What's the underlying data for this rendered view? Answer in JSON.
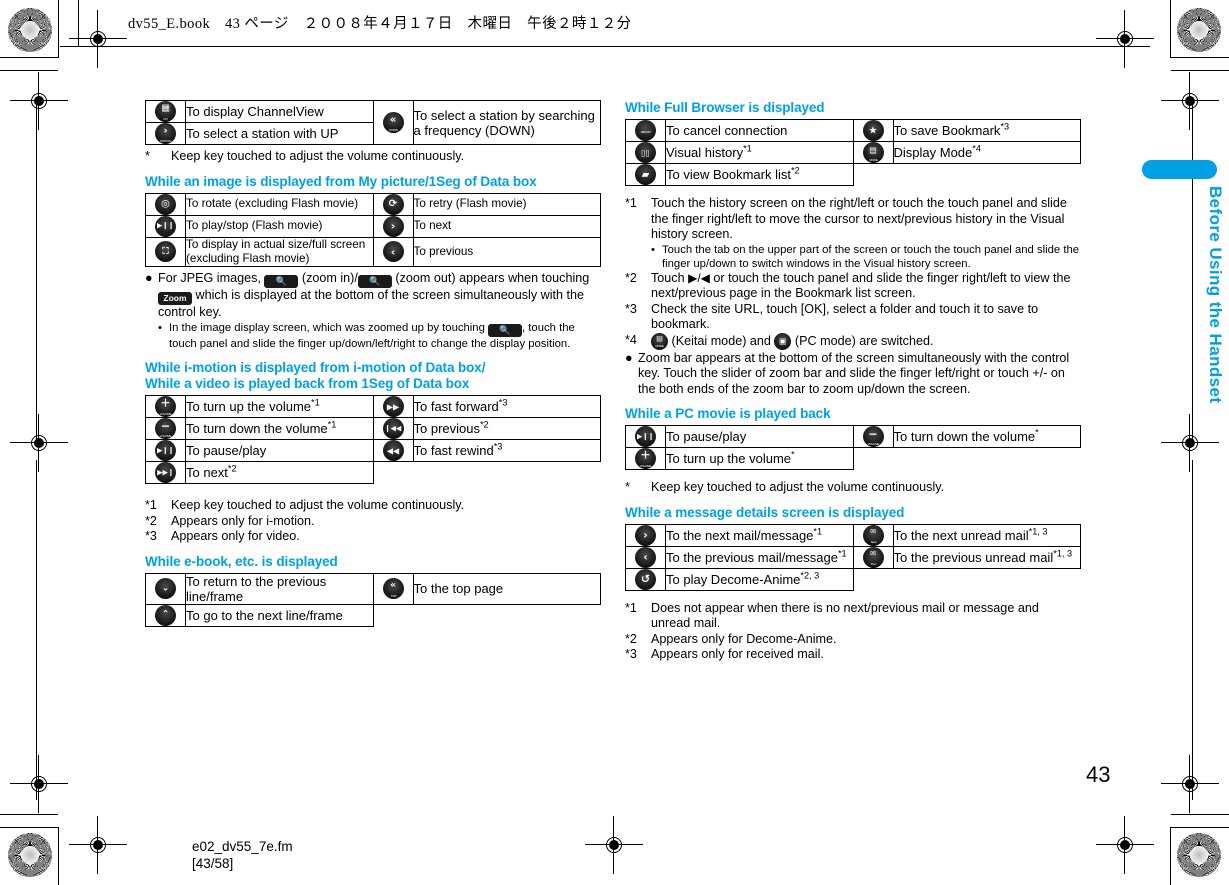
{
  "header": {
    "text": "dv55_E.book　43 ページ　２００８年４月１７日　木曜日　午後２時１２分"
  },
  "side_tab": {
    "label": "Before Using the Handset"
  },
  "footer": {
    "page_number": "43",
    "file_name": "e02_dv55_7e.fm",
    "file_range": "[43/58]"
  },
  "colors": {
    "accent": "#00a0e3",
    "text": "#000000",
    "icon": "#000000"
  },
  "left_column": {
    "table_channelview": {
      "rows": [
        {
          "icon": "channelview-key-icon",
          "glyph": "▦",
          "sub": "CH",
          "text": "To display ChannelView",
          "icon2": "search-down-key-icon",
          "glyph2": "«",
          "sub2": "DOWN",
          "text2": "To select a station by searching a frequency (DOWN)",
          "rowspan2": 2
        },
        {
          "icon": "station-up-key-icon",
          "glyph": "›",
          "sub": "STATION",
          "text": "To select a station with UP"
        }
      ]
    },
    "note_star": {
      "mark": "*",
      "text": "Keep key touched to adjust the volume continuously."
    },
    "section_image": {
      "title": "While an image is displayed from My picture/1Seg of Data box",
      "rows": [
        {
          "icon": "rotate-key-icon",
          "glyph": "◎",
          "sub": "ROTATE",
          "text": "To rotate (excluding Flash movie)",
          "icon2": "retry-key-icon",
          "glyph2": "⟳",
          "sub2": "RETRY",
          "text2": "To retry (Flash movie)"
        },
        {
          "icon": "play-stop-key-icon",
          "glyph": "▶❙❙",
          "sub": "",
          "text": "To play/stop (Flash movie)",
          "icon2": "next-key-icon",
          "glyph2": "›",
          "sub2": "",
          "text2": "To next"
        },
        {
          "icon": "actual-size-key-icon",
          "glyph": "⛶",
          "sub": "SIZE",
          "text": "To display in actual size/full screen (excluding Flash movie)",
          "icon2": "previous-key-icon",
          "glyph2": "‹",
          "sub2": "",
          "text2": "To previous"
        }
      ]
    },
    "jpeg_bullet": {
      "part1": "For JPEG images,",
      "zoom_in_label": "zoom-in-button",
      "part2": "(zoom in)/",
      "zoom_out_label": "zoom-out-button",
      "part3": "(zoom out) appears when touching",
      "zoom_pill": "Zoom",
      "part4": "which is displayed at the bottom of the screen simultaneously with the control key."
    },
    "jpeg_subbullet": {
      "part1": "In the image display screen, which was zoomed up by touching",
      "part2": ", touch the touch panel and slide the finger up/down/left/right to change the display position."
    },
    "section_imotion": {
      "title_line1": "While i-motion is displayed from i-motion of Data box/",
      "title_line2": "While a video is played back from 1Seg of Data box",
      "rows": [
        {
          "icon": "volume-up-key-icon",
          "glyph": "＋",
          "sub": "VOLUME",
          "text": "To turn up the volume",
          "sup": "*1",
          "icon2": "fast-forward-key-icon",
          "glyph2": "▶▶",
          "sub2": "",
          "text2": "To fast forward",
          "sup2": "*3"
        },
        {
          "icon": "volume-down-key-icon",
          "glyph": "−",
          "sub": "VOLUME",
          "text": "To turn down the volume",
          "sup": "*1",
          "icon2": "previous-track-key-icon",
          "glyph2": "❙◀◀",
          "sub2": "",
          "text2": "To previous",
          "sup2": "*2"
        },
        {
          "icon": "pause-play-key-icon",
          "glyph": "▶❙❙",
          "sub": "",
          "text": "To pause/play",
          "sup": "",
          "icon2": "fast-rewind-key-icon",
          "glyph2": "◀◀",
          "sub2": "",
          "text2": "To fast rewind",
          "sup2": "*3"
        },
        {
          "icon": "next-track-key-icon",
          "glyph": "▶▶❙",
          "sub": "",
          "text": "To next",
          "sup": "*2"
        }
      ]
    },
    "footnotes_imotion": [
      {
        "mark": "*1",
        "text": "Keep key touched to adjust the volume continuously."
      },
      {
        "mark": "*2",
        "text": "Appears only for i-motion."
      },
      {
        "mark": "*3",
        "text": "Appears only for video."
      }
    ],
    "section_ebook": {
      "title": "While e-book, etc. is displayed",
      "rows": [
        {
          "icon": "previous-line-key-icon",
          "glyph": "⌄",
          "sub": "",
          "text": "To return to the previous line/frame",
          "icon2": "top-page-key-icon",
          "glyph2": "«",
          "sub2": "TOP",
          "text2": "To the top page"
        },
        {
          "icon": "next-line-key-icon",
          "glyph": "⌃",
          "sub": "",
          "text": "To go to the next line/frame"
        }
      ]
    }
  },
  "right_column": {
    "section_fullbrowser": {
      "title": "While Full Browser is displayed",
      "rows": [
        {
          "icon": "cancel-connection-key-icon",
          "glyph": "",
          "sub": "cancel",
          "text": "To cancel connection",
          "sup": "",
          "icon2": "save-bookmark-key-icon",
          "glyph2": "★",
          "sub2": "",
          "text2": "To save Bookmark",
          "sup2": "*3"
        },
        {
          "icon": "visual-history-key-icon",
          "glyph": "▯▯",
          "sub": "",
          "text": "Visual history",
          "sup": "*1",
          "icon2": "display-mode-key-icon",
          "glyph2": "▤",
          "sub2": "MODE",
          "text2": "Display Mode",
          "sup2": "*4"
        },
        {
          "icon": "bookmark-list-key-icon",
          "glyph": "▰",
          "sub": "",
          "text": "To view Bookmark list",
          "sup": "*2"
        }
      ]
    },
    "footnotes_browser": [
      {
        "mark": "*1",
        "text": "Touch the history screen on the right/left or touch the touch panel and slide the finger right/left to move the cursor to next/previous history in the Visual history screen."
      },
      {
        "mark": "*2",
        "prefix": "Touch ",
        "glyph": "▶/◀",
        "text": " or touch the touch panel and slide the finger right/left to view the next/previous page in the Bookmark list screen."
      },
      {
        "mark": "*3",
        "text": "Check the site URL, touch [OK], select a folder and touch it to save to bookmark."
      },
      {
        "mark": "*4",
        "text_before": "(Keitai mode) and",
        "text_after": "(PC mode) are switched."
      }
    ],
    "subbullet_browser": "Touch the tab on the upper part of the screen or touch the touch panel and slide the finger up/down to switch windows in the Visual history screen.",
    "bullet_zoombar": "Zoom bar appears at the bottom of the screen simultaneously with the control key. Touch the slider of zoom bar and slide the finger left/right or touch +/- on the both ends of the zoom bar to zoom up/down the screen.",
    "section_pcmovie": {
      "title": "While a PC movie is played back",
      "rows": [
        {
          "icon": "pause-play-key-icon",
          "glyph": "▶❙❙",
          "sub": "",
          "text": "To pause/play",
          "sup": "",
          "icon2": "volume-down-key-icon",
          "glyph2": "−",
          "sub2": "VOLUME",
          "text2": "To turn down the volume",
          "sup2": "*"
        },
        {
          "icon": "volume-up-key-icon",
          "glyph": "＋",
          "sub": "VOLUME",
          "text": "To turn up the volume",
          "sup": "*"
        }
      ],
      "note": {
        "mark": "*",
        "text": "Keep key touched to adjust the volume continuously."
      }
    },
    "section_message": {
      "title": "While a message details screen is displayed",
      "rows": [
        {
          "icon": "next-mail-key-icon",
          "glyph": "›",
          "sub": "",
          "text": "To the next mail/message",
          "sup": "*1",
          "icon2": "next-unread-mail-key-icon",
          "glyph2": "✉",
          "sub2": "Next",
          "text2": "To the next unread mail",
          "sup2": "*1, 3"
        },
        {
          "icon": "previous-mail-key-icon",
          "glyph": "‹",
          "sub": "",
          "text": "To the previous mail/message",
          "sup": "*1",
          "icon2": "previous-unread-mail-key-icon",
          "glyph2": "✉",
          "sub2": "Prev",
          "text2": "To the previous unread mail",
          "sup2": "*1, 3"
        },
        {
          "icon": "play-decome-anime-key-icon",
          "glyph": "↺",
          "sub": "",
          "text": "To play Decome-Anime",
          "sup": "*2, 3"
        }
      ]
    },
    "footnotes_message": [
      {
        "mark": "*1",
        "text": "Does not appear when there is no next/previous mail or message and unread mail."
      },
      {
        "mark": "*2",
        "text": "Appears only for Decome-Anime."
      },
      {
        "mark": "*3",
        "text": "Appears only for received mail."
      }
    ]
  }
}
